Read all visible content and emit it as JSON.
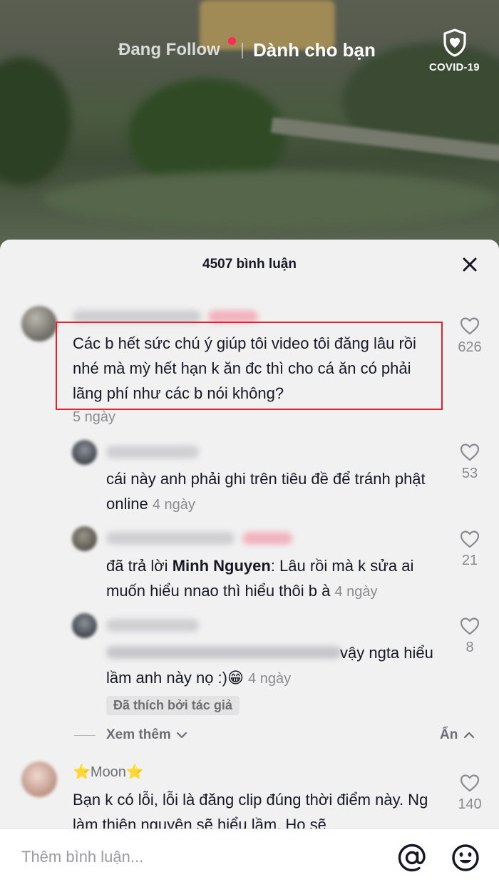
{
  "header": {
    "tab_following": "Đang Follow",
    "tab_for_you": "Dành cho bạn",
    "covid_label": "COVID-19",
    "covid_icon": "shield-heart-icon"
  },
  "sheet": {
    "title": "4507 bình luận",
    "close_icon": "close-icon"
  },
  "comments": [
    {
      "text": "Các b hết sức chú ý giúp tôi video tôi đăng lâu rồi nhé mà mỳ hết hạn k ăn đc thì cho cá ăn có phải lãng phí như các b nói không?",
      "time": "5 ngày",
      "likes": "626"
    },
    {
      "text": "cái này anh phải ghi trên tiêu đề để tránh phật online",
      "time": "4 ngày",
      "likes": "53"
    },
    {
      "prefix": "đã trả lời ",
      "mention": "Minh Nguyen",
      "text": ": Lâu rồi mà k sửa ai muốn hiểu nnao thì hiểu thôi b à",
      "time": "4 ngày",
      "likes": "21"
    },
    {
      "text": "vậy ngta hiểu lầm anh này nọ :)😁",
      "time": "4 ngày",
      "likes": "8",
      "liked_by_author": "Đã thích bởi tác giả"
    },
    {
      "author": "⭐Moon⭐",
      "text": "Bạn k có lỗi, lỗi là đăng clip đúng thời điểm này. Ng làm thiện nguyện sẽ hiểu lầm. Họ sẽ",
      "likes": "140"
    }
  ],
  "thread": {
    "see_more": "Xem thêm",
    "hide": "Ẩn"
  },
  "input": {
    "placeholder": "Thêm bình luận...",
    "mention_icon": "at-icon",
    "emoji_icon": "emoji-icon"
  },
  "colors": {
    "accent": "#fe2c55",
    "highlight": "#e0242d"
  }
}
